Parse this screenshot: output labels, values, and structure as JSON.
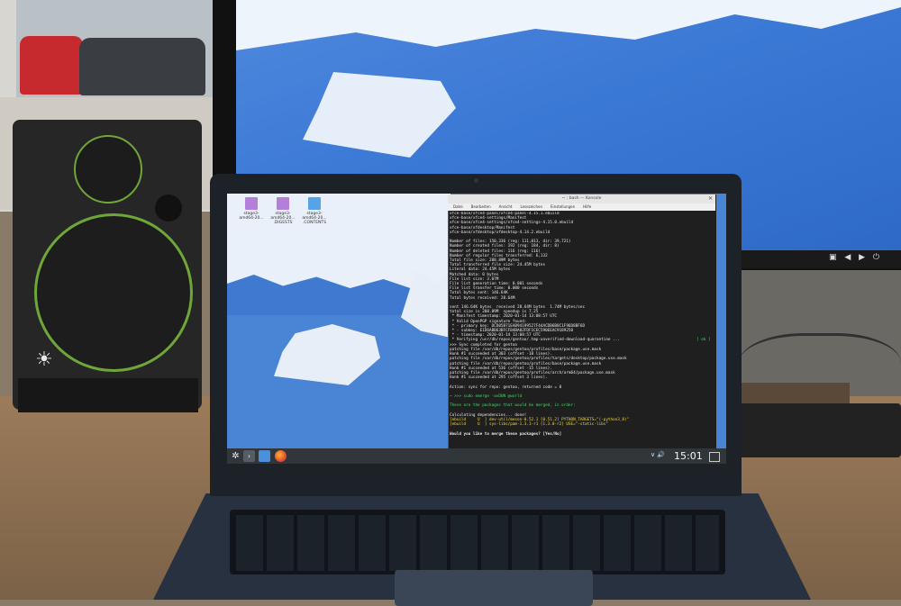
{
  "scene": {
    "description_colors": {
      "desk": "#a4825f",
      "wallpaper_blue": "#4a84d5",
      "terminal_bg": "#1f1f1f",
      "taskbar": "#31363b"
    }
  },
  "desktop": {
    "icons": [
      {
        "label": "stage3-amd64-20...",
        "icon": "archive-file-icon"
      },
      {
        "label": "stage3-amd64-20... .DIGESTS",
        "icon": "archive-file-icon"
      },
      {
        "label": "stage3-amd64-20... .CONTENTS",
        "icon": "folder-icon"
      }
    ]
  },
  "terminal": {
    "title": "~ : bash — Konsole",
    "menu": [
      "Datei",
      "Bearbeiten",
      "Ansicht",
      "Lesezeichen",
      "Einstellungen",
      "Hilfe"
    ],
    "lines": [
      {
        "text": "xfce-base/xfce4-panel/xfce4-panel-4.15.1.ebuild",
        "cls": ""
      },
      {
        "text": "xfce-base/xfce4-settings/Manifest",
        "cls": ""
      },
      {
        "text": "xfce-base/xfce4-settings/xfce4-settings-4.15.0.ebuild",
        "cls": ""
      },
      {
        "text": "xfce-base/xfdesktop/Manifest",
        "cls": ""
      },
      {
        "text": "xfce-base/xfdesktop/xfdesktop-4.14.2.ebuild",
        "cls": ""
      },
      {
        "text": "",
        "cls": ""
      },
      {
        "text": "Number of files: 150,336 (reg: 111,013, dir: 39,721)",
        "cls": ""
      },
      {
        "text": "Number of created files: 192 (reg: 184, dir: 8)",
        "cls": ""
      },
      {
        "text": "Number of deleted files: 116 (reg: 116)",
        "cls": ""
      },
      {
        "text": "Number of regular files transferred: 6,132",
        "cls": ""
      },
      {
        "text": "Total file size: 208.89M bytes",
        "cls": ""
      },
      {
        "text": "Total transferred file size: 24.45M bytes",
        "cls": ""
      },
      {
        "text": "Literal data: 24.45M bytes",
        "cls": ""
      },
      {
        "text": "Matched data: 0 bytes",
        "cls": ""
      },
      {
        "text": "File list size: 3.07M",
        "cls": ""
      },
      {
        "text": "File list generation time: 0.001 seconds",
        "cls": ""
      },
      {
        "text": "File list transfer time: 0.000 seconds",
        "cls": ""
      },
      {
        "text": "Total bytes sent: 146.64K",
        "cls": ""
      },
      {
        "text": "Total bytes received: 28.64M",
        "cls": ""
      },
      {
        "text": "",
        "cls": ""
      },
      {
        "text": "sent 146.64K bytes  received 28.64M bytes  1.74M bytes/sec",
        "cls": ""
      },
      {
        "text": "total size is 208.89M  speedup is 7.25",
        "cls": ""
      },
      {
        "text": " * Manifest timestamp: 2020-01-14 13:08:57 UTC",
        "cls": ""
      },
      {
        "text": " * Valid OpenPGP signature found:",
        "cls": ""
      },
      {
        "text": " * - primary key: DCD05B71EAB94199527F44ACDB6B8C1F96D8BF6D",
        "cls": ""
      },
      {
        "text": " * - subkey: E1D6ABB63BFCFB4BA02FDF1CEC590EEAC9189250",
        "cls": ""
      },
      {
        "text": " * - timestamp: 2020-01-14 13:08:57 UTC",
        "cls": ""
      },
      {
        "text": " * Verifying /usr/db/repos/gentoo/.tmp-unverified-download-quarantine ...",
        "cls": ""
      },
      {
        "text": ">>> Sync completed for gentoo",
        "cls": ""
      },
      {
        "text": "patching file /var/db/repos/gentoo/profiles/base/package.use.mask",
        "cls": ""
      },
      {
        "text": "Hunk #1 succeeded at 303 (offset -18 lines).",
        "cls": ""
      },
      {
        "text": "patching file /var/db/repos/gentoo/profiles/targets/desktop/package.use.mask",
        "cls": ""
      },
      {
        "text": "patching file /var/db/repos/gentoo/profiles/base/package.use.mask",
        "cls": ""
      },
      {
        "text": "Hunk #1 succeeded at 536 (offset -15 lines).",
        "cls": ""
      },
      {
        "text": "patching file /var/db/repos/gentoo/profiles/arch/arm64/package.use.mask",
        "cls": ""
      },
      {
        "text": "Hunk #1 succeeded at 295 (offset 3 lines).",
        "cls": ""
      },
      {
        "text": "",
        "cls": ""
      },
      {
        "text": "Action: sync for repo: gentoo, returned code = 0",
        "cls": ""
      },
      {
        "text": "",
        "cls": ""
      },
      {
        "text": "~ >>> sudo emerge -avDUN @world",
        "cls": "t-green"
      },
      {
        "text": "",
        "cls": ""
      },
      {
        "text": "These are the packages that would be merged, in order:",
        "cls": "t-green"
      },
      {
        "text": "",
        "cls": ""
      },
      {
        "text": "Calculating dependencies... done!",
        "cls": ""
      },
      {
        "text": "[ebuild     U  ] dev-util/meson-0.52.1 [0.51.2] PYTHON_TARGETS=\"(-python3_8)\"",
        "cls": "t-yellow"
      },
      {
        "text": "[ebuild     U  ] sys-libs/pam-1.3.1-r1 [1.3.0-r2] USE=\"-static-libs\"",
        "cls": "t-yellow"
      },
      {
        "text": "",
        "cls": ""
      },
      {
        "text": "Would you like to merge these packages? [Yes/No]",
        "cls": "t-bold"
      }
    ],
    "ok_badge": "[ ok ]"
  },
  "taskbar": {
    "clock": "15:01",
    "tray": "∨ 🔊"
  },
  "monitor": {
    "controls": "▣ ◀ ▶ ⏻"
  },
  "speaker": {
    "logo": "☀"
  }
}
